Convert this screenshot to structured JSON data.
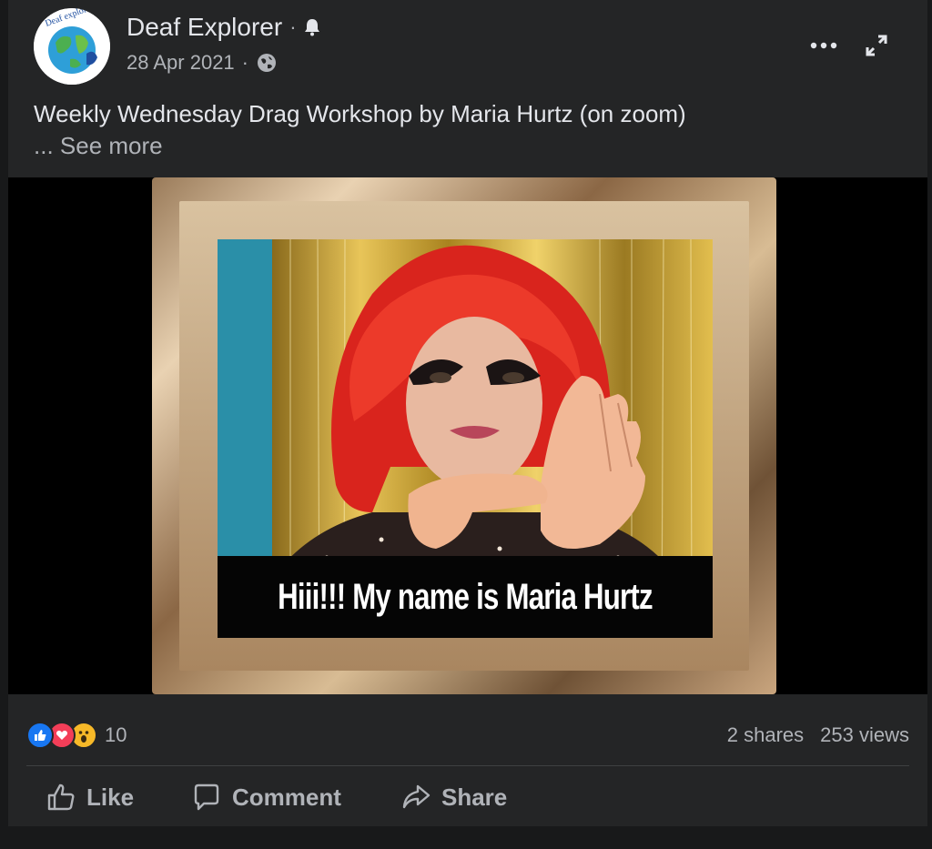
{
  "post": {
    "author": "Deaf Explorer",
    "separator": "·",
    "date": "28 Apr 2021",
    "date_separator": "·",
    "caption": "Weekly Wednesday Drag Workshop by Maria Hurtz (on zoom)",
    "see_more_prefix": "...",
    "see_more": "See more",
    "avatar_text": "Deaf explorer"
  },
  "media": {
    "subtitle": "Hiii!!! My name is Maria Hurtz"
  },
  "stats": {
    "reaction_count": "10",
    "shares": "2 shares",
    "views": "253 views",
    "reactions": [
      "like-icon",
      "love-icon",
      "wow-icon"
    ]
  },
  "actions": {
    "like": "Like",
    "comment": "Comment",
    "share": "Share"
  },
  "colors": {
    "background": "#18191a",
    "card": "#242526",
    "text_primary": "#e4e6eb",
    "text_secondary": "#b0b3b8",
    "like_blue": "#1877f2",
    "love_red": "#f33e58",
    "wow_yellow": "#f7b928"
  }
}
